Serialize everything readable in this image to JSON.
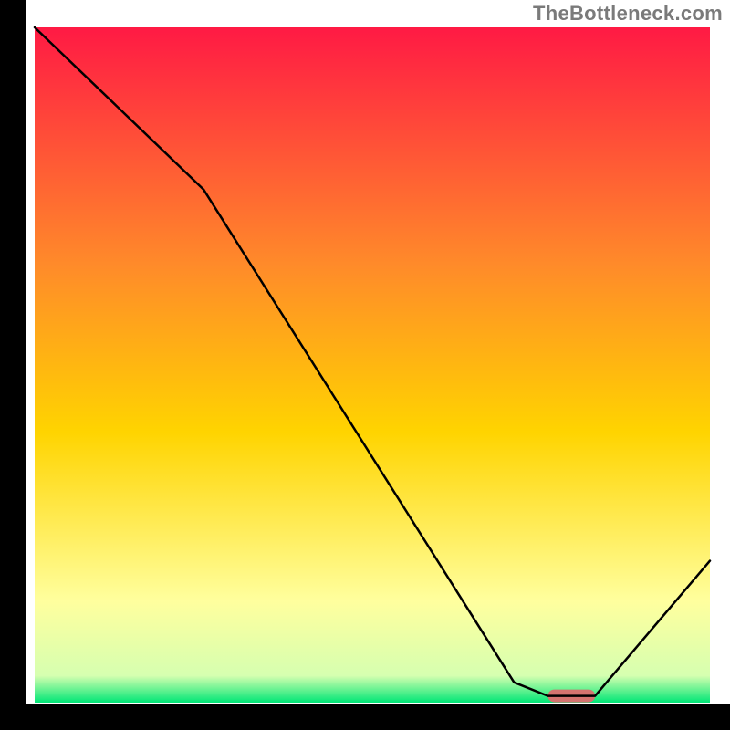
{
  "watermark": "TheBottleneck.com",
  "chart_data": {
    "type": "line",
    "title": "",
    "xlabel": "",
    "ylabel": "",
    "xlim": [
      0,
      100
    ],
    "ylim": [
      0,
      100
    ],
    "x": [
      0,
      25,
      71,
      76,
      83,
      100
    ],
    "values": [
      100,
      76,
      3,
      1,
      1,
      21
    ],
    "highlight_range_x": [
      76,
      83
    ],
    "colors": {
      "gradient_top": "#ff1a44",
      "gradient_mid": "#ffd400",
      "gradient_low": "#ffff9e",
      "gradient_bottom": "#00e676",
      "curve": "#000000",
      "highlight": "#d4736f",
      "frame": "#000000"
    }
  }
}
